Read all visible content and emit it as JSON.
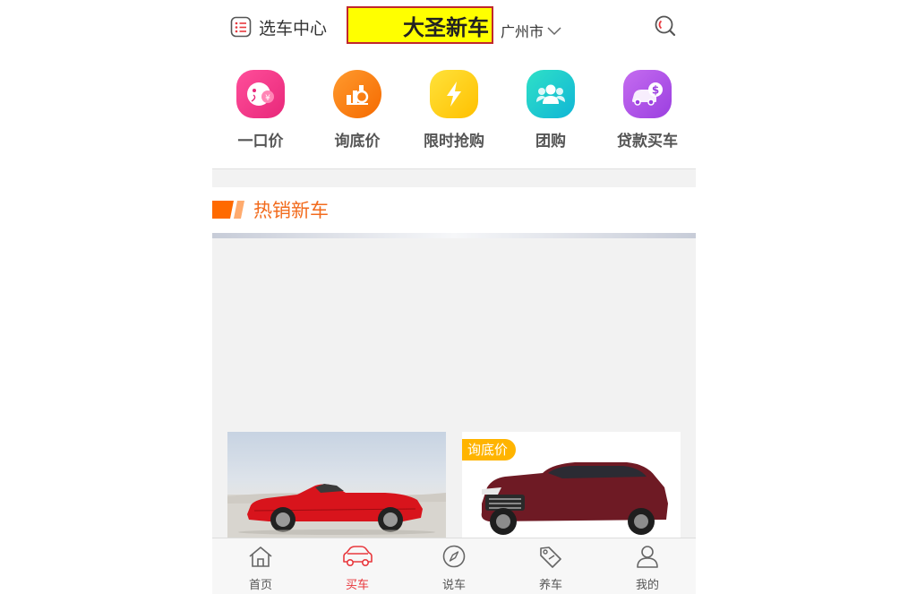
{
  "header": {
    "select_center_label": "选车中心",
    "brand_name": "大圣新车",
    "city": "广州市"
  },
  "entries": [
    {
      "label": "一口价",
      "icon": "fixed-price-icon",
      "color": "#f0327f"
    },
    {
      "label": "询底价",
      "icon": "ask-price-icon",
      "color": "#fb7a14"
    },
    {
      "label": "限时抢购",
      "icon": "flash-sale-icon",
      "color": "#ffd000"
    },
    {
      "label": "团购",
      "icon": "group-buy-icon",
      "color": "#11c8c8"
    },
    {
      "label": "贷款买车",
      "icon": "loan-car-icon",
      "color": "#b34ee6"
    }
  ],
  "section": {
    "title": "热销新车",
    "accent": "#f26b1d"
  },
  "cards": [
    {
      "name": "red-convertible-car",
      "badge": ""
    },
    {
      "name": "dark-red-suv",
      "badge": "询底价"
    }
  ],
  "tabbar": {
    "items": [
      {
        "label": "首页",
        "icon": "home-icon",
        "active": false
      },
      {
        "label": "买车",
        "icon": "car-icon",
        "active": true
      },
      {
        "label": "说车",
        "icon": "compass-icon",
        "active": false
      },
      {
        "label": "养车",
        "icon": "tag-icon",
        "active": false
      },
      {
        "label": "我的",
        "icon": "user-icon",
        "active": false
      }
    ],
    "active_color": "#e8383d"
  }
}
